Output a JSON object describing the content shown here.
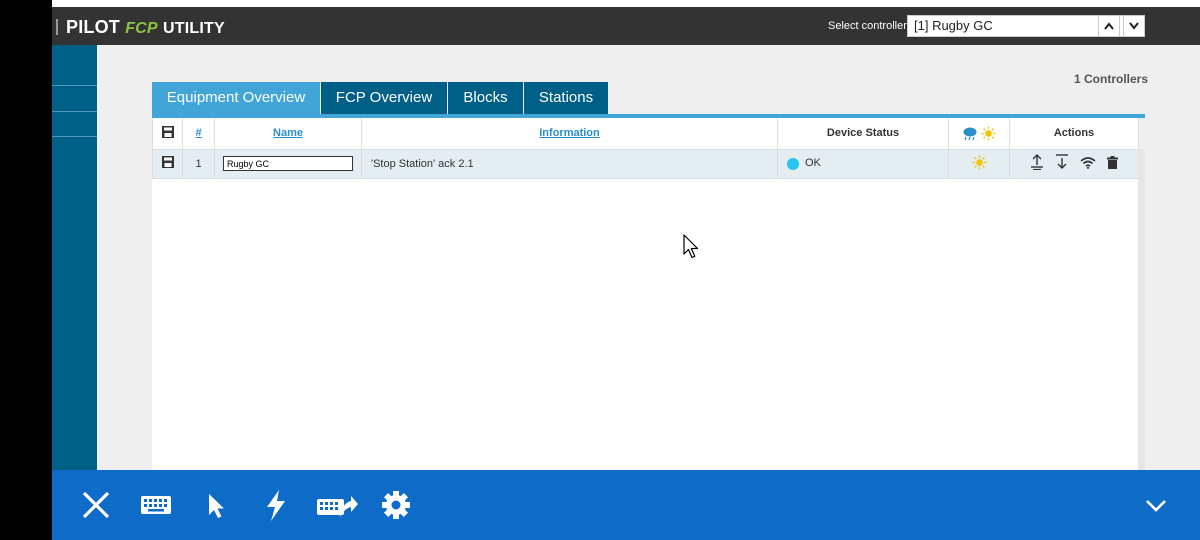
{
  "app": {
    "title_main": "PILOT",
    "title_fcp": "FCP",
    "title_util": "UTILITY"
  },
  "controller_select": {
    "label": "Select controller:",
    "value": "[1] Rugby GC"
  },
  "main": {
    "controllers_count": "1 Controllers",
    "tabs": [
      {
        "label": "Equipment Overview",
        "active": true
      },
      {
        "label": "FCP Overview",
        "active": false
      },
      {
        "label": "Blocks",
        "active": false
      },
      {
        "label": "Stations",
        "active": false
      }
    ],
    "table": {
      "headers": {
        "index": "#",
        "name": "Name",
        "information": "Information",
        "device_status": "Device Status",
        "actions": "Actions"
      },
      "rows": [
        {
          "index": "1",
          "name": "Rugby GC",
          "information": "'Stop Station' ack   2.1",
          "status": "OK",
          "status_color": "#26c6ef"
        }
      ]
    }
  },
  "colors": {
    "header_bg": "#333333",
    "sidebar_bg": "#005f87",
    "tab_active": "#42a5d8",
    "tab_inactive": "#005f87",
    "toolbar_bg": "#0f6bc8",
    "link": "#2a8fc7",
    "fcp_green": "#8cc63f"
  },
  "toolbar": {
    "icons": [
      "close-icon",
      "keyboard-icon",
      "pointer-icon",
      "lightning-icon",
      "keyboard-share-icon",
      "gear-icon",
      "chevron-down-icon"
    ]
  }
}
